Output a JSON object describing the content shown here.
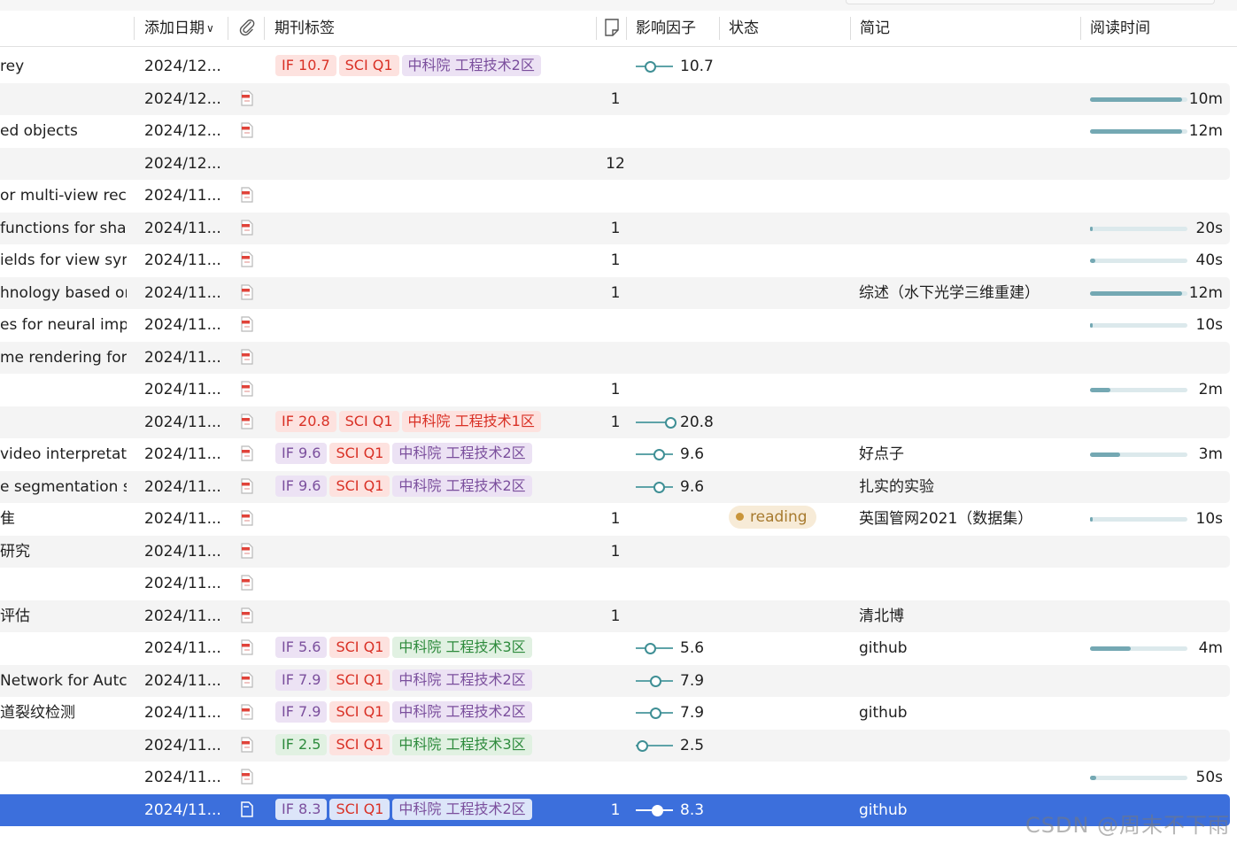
{
  "columns": {
    "added_date": "添加日期",
    "tags": "期刊标签",
    "impact": "影响因子",
    "status": "状态",
    "memo": "简记",
    "read_time": "阅读时间"
  },
  "rows": [
    {
      "title": "rey",
      "date": "2024/12...",
      "pdf": false,
      "tags": [
        {
          "t": "IF 10.7",
          "c": "red"
        },
        {
          "t": "SCI Q1",
          "c": "red"
        },
        {
          "t": "中科院 工程技术2区",
          "c": "purple"
        }
      ],
      "notes": "",
      "if": "10.7",
      "if_pos": 0.35,
      "status": "",
      "memo": "",
      "read": "",
      "read_frac": null
    },
    {
      "title": "",
      "date": "2024/12...",
      "pdf": true,
      "tags": [],
      "notes": "1",
      "if": "",
      "if_pos": null,
      "status": "",
      "memo": "",
      "read": "10m",
      "read_frac": 1.0
    },
    {
      "title": "ed objects",
      "date": "2024/12...",
      "pdf": true,
      "tags": [],
      "notes": "",
      "if": "",
      "if_pos": null,
      "status": "",
      "memo": "",
      "read": "12m",
      "read_frac": 1.0
    },
    {
      "title": "",
      "date": "2024/12...",
      "pdf": false,
      "tags": [],
      "notes": "12",
      "if": "",
      "if_pos": null,
      "status": "",
      "memo": "",
      "read": "",
      "read_frac": null
    },
    {
      "title": "or multi-view reco",
      "date": "2024/11...",
      "pdf": true,
      "tags": [],
      "notes": "",
      "if": "",
      "if_pos": null,
      "status": "",
      "memo": "",
      "read": "",
      "read_frac": null
    },
    {
      "title": " functions for sha",
      "date": "2024/11...",
      "pdf": true,
      "tags": [],
      "notes": "1",
      "if": "",
      "if_pos": null,
      "status": "",
      "memo": "",
      "read": "20s",
      "read_frac": 0.03
    },
    {
      "title": "ields for view syn",
      "date": "2024/11...",
      "pdf": true,
      "tags": [],
      "notes": "1",
      "if": "",
      "if_pos": null,
      "status": "",
      "memo": "",
      "read": "40s",
      "read_frac": 0.06
    },
    {
      "title": "hnology based or",
      "date": "2024/11...",
      "pdf": true,
      "tags": [],
      "notes": "1",
      "if": "",
      "if_pos": null,
      "status": "",
      "memo": "综述（水下光学三维重建）",
      "read": "12m",
      "read_frac": 1.0
    },
    {
      "title": "es for neural impli",
      "date": "2024/11...",
      "pdf": true,
      "tags": [],
      "notes": "",
      "if": "",
      "if_pos": null,
      "status": "",
      "memo": "",
      "read": "10s",
      "read_frac": 0.015
    },
    {
      "title": "me rendering for",
      "date": "2024/11...",
      "pdf": true,
      "tags": [],
      "notes": "",
      "if": "",
      "if_pos": null,
      "status": "",
      "memo": "",
      "read": "",
      "read_frac": null
    },
    {
      "title": "",
      "date": "2024/11...",
      "pdf": true,
      "tags": [],
      "notes": "1",
      "if": "",
      "if_pos": null,
      "status": "",
      "memo": "",
      "read": "2m",
      "read_frac": 0.22
    },
    {
      "title": "",
      "date": "2024/11...",
      "pdf": true,
      "tags": [
        {
          "t": "IF 20.8",
          "c": "red"
        },
        {
          "t": "SCI Q1",
          "c": "red"
        },
        {
          "t": "中科院 工程技术1区",
          "c": "red"
        }
      ],
      "notes": "1",
      "if": "20.8",
      "if_pos": 0.95,
      "status": "",
      "memo": "",
      "read": "",
      "read_frac": null
    },
    {
      "title": "video interpretatic",
      "date": "2024/11...",
      "pdf": true,
      "tags": [
        {
          "t": "IF 9.6",
          "c": "purple"
        },
        {
          "t": "SCI Q1",
          "c": "red"
        },
        {
          "t": "中科院 工程技术2区",
          "c": "purple"
        }
      ],
      "notes": "",
      "if": "9.6",
      "if_pos": 0.6,
      "status": "",
      "memo": "好点子",
      "read": "3m",
      "read_frac": 0.33
    },
    {
      "title": "e segmentation sy",
      "date": "2024/11...",
      "pdf": true,
      "tags": [
        {
          "t": "IF 9.6",
          "c": "purple"
        },
        {
          "t": "SCI Q1",
          "c": "red"
        },
        {
          "t": "中科院 工程技术2区",
          "c": "purple"
        }
      ],
      "notes": "",
      "if": "9.6",
      "if_pos": 0.6,
      "status": "",
      "memo": "扎实的实验",
      "read": "",
      "read_frac": null
    },
    {
      "title": "隹",
      "date": "2024/11...",
      "pdf": true,
      "tags": [],
      "notes": "1",
      "if": "",
      "if_pos": null,
      "status": "reading",
      "memo": "英国管网2021（数据集）",
      "read": "10s",
      "read_frac": 0.015
    },
    {
      "title": "研究",
      "date": "2024/11...",
      "pdf": true,
      "tags": [],
      "notes": "1",
      "if": "",
      "if_pos": null,
      "status": "",
      "memo": "",
      "read": "",
      "read_frac": null
    },
    {
      "title": "",
      "date": "2024/11...",
      "pdf": true,
      "tags": [],
      "notes": "",
      "if": "",
      "if_pos": null,
      "status": "",
      "memo": "",
      "read": "",
      "read_frac": null
    },
    {
      "title": "评估",
      "date": "2024/11...",
      "pdf": true,
      "tags": [],
      "notes": "1",
      "if": "",
      "if_pos": null,
      "status": "",
      "memo": "清北博",
      "read": "",
      "read_frac": null
    },
    {
      "title": "",
      "date": "2024/11...",
      "pdf": true,
      "tags": [
        {
          "t": "IF 5.6",
          "c": "purple"
        },
        {
          "t": "SCI Q1",
          "c": "red"
        },
        {
          "t": "中科院 工程技术3区",
          "c": "green"
        }
      ],
      "notes": "",
      "if": "5.6",
      "if_pos": 0.35,
      "status": "",
      "memo": "github",
      "read": "4m",
      "read_frac": 0.44
    },
    {
      "title": " Network for Autc",
      "date": "2024/11...",
      "pdf": true,
      "tags": [
        {
          "t": "IF 7.9",
          "c": "purple"
        },
        {
          "t": "SCI Q1",
          "c": "red"
        },
        {
          "t": "中科院 工程技术2区",
          "c": "purple"
        }
      ],
      "notes": "",
      "if": "7.9",
      "if_pos": 0.5,
      "status": "",
      "memo": "",
      "read": "",
      "read_frac": null
    },
    {
      "title": "道裂纹检测",
      "date": "2024/11...",
      "pdf": true,
      "tags": [
        {
          "t": "IF 7.9",
          "c": "purple"
        },
        {
          "t": "SCI Q1",
          "c": "red"
        },
        {
          "t": "中科院 工程技术2区",
          "c": "purple"
        }
      ],
      "notes": "",
      "if": "7.9",
      "if_pos": 0.5,
      "status": "",
      "memo": "github",
      "read": "",
      "read_frac": null
    },
    {
      "title": "",
      "date": "2024/11...",
      "pdf": true,
      "tags": [
        {
          "t": "IF 2.5",
          "c": "green"
        },
        {
          "t": "SCI Q1",
          "c": "red"
        },
        {
          "t": "中科院 工程技术3区",
          "c": "green"
        }
      ],
      "notes": "",
      "if": "2.5",
      "if_pos": 0.1,
      "status": "",
      "memo": "",
      "read": "",
      "read_frac": null
    },
    {
      "title": "",
      "date": "2024/11...",
      "pdf": true,
      "tags": [],
      "notes": "",
      "if": "",
      "if_pos": null,
      "status": "",
      "memo": "",
      "read": "50s",
      "read_frac": 0.07
    },
    {
      "title": "",
      "date": "2024/11...",
      "pdf": true,
      "tags": [
        {
          "t": "IF 8.3",
          "c": "purple"
        },
        {
          "t": "SCI Q1",
          "c": "red"
        },
        {
          "t": "中科院 工程技术2区",
          "c": "purple"
        }
      ],
      "notes": "1",
      "if": "8.3",
      "if_pos": 0.55,
      "status": "",
      "memo": "github",
      "read": "",
      "read_frac": null,
      "selected": true
    }
  ],
  "watermark": "CSDN @周末不下雨",
  "colors": {
    "accent": "#3c6fdc",
    "if_line": "#3f8f95",
    "read_fill": "#74a8b3"
  }
}
